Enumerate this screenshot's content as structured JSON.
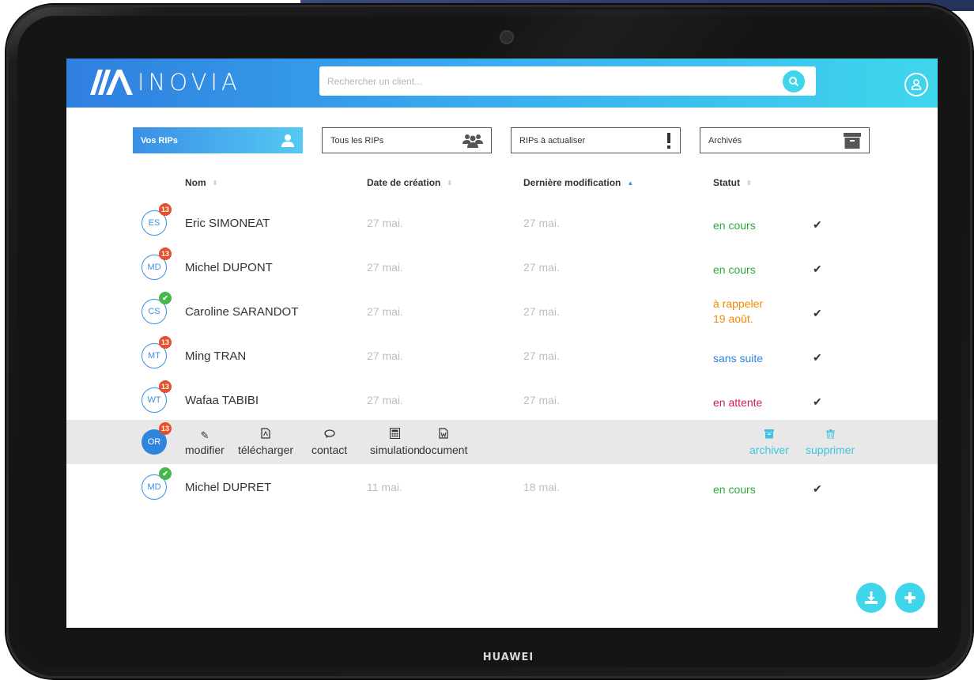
{
  "app": {
    "logo_text": "INOVIA",
    "device_brand": "HUAWEI",
    "accent": "#3a8fe6",
    "accent_light": "#3fd6ec"
  },
  "search": {
    "placeholder": "Rechercher un client..."
  },
  "tabs": [
    {
      "label": "Vos RIPs",
      "icon": "user-icon",
      "active": true
    },
    {
      "label": "Tous les RIPs",
      "icon": "users-icon",
      "active": false
    },
    {
      "label": "RIPs à actualiser",
      "icon": "exclamation-icon",
      "active": false
    },
    {
      "label": "Archivés",
      "icon": "archive-box-icon",
      "active": false
    }
  ],
  "columns": {
    "name": "Nom",
    "created": "Date de création",
    "modified": "Dernière modification",
    "status": "Statut"
  },
  "rows": [
    {
      "initials": "ES",
      "badge": "13",
      "name": "Eric SIMONEAT",
      "created": "27 mai.",
      "modified": "27 mai.",
      "status": "en cours",
      "status_date": ""
    },
    {
      "initials": "MD",
      "badge": "13",
      "name": "Michel DUPONT",
      "created": "27 mai.",
      "modified": "27 mai.",
      "status": "en cours",
      "status_date": ""
    },
    {
      "initials": "CS",
      "badge": "✔",
      "name": "Caroline SARANDOT",
      "created": "27 mai.",
      "modified": "27 mai.",
      "status": "à rappeler",
      "status_date": "19 août."
    },
    {
      "initials": "MT",
      "badge": "13",
      "name": "Ming TRAN",
      "created": "27 mai.",
      "modified": "27 mai.",
      "status": "sans suite",
      "status_date": ""
    },
    {
      "initials": "WT",
      "badge": "13",
      "name": "Wafaa TABIBI",
      "created": "27 mai.",
      "modified": "27 mai.",
      "status": "en attente",
      "status_date": ""
    }
  ],
  "action_row": {
    "initials": "OR",
    "badge": "13",
    "actions": {
      "edit": "modifier",
      "download": "télécharger",
      "contact": "contact",
      "simulation": "simulation",
      "document": "document",
      "archive": "archiver",
      "delete": "supprimer"
    }
  },
  "last_row": {
    "initials": "MD",
    "badge": "✔",
    "name": "Michel DUPRET",
    "created": "11 mai.",
    "modified": "18 mai.",
    "status": "en cours"
  },
  "check_mark": "✔"
}
